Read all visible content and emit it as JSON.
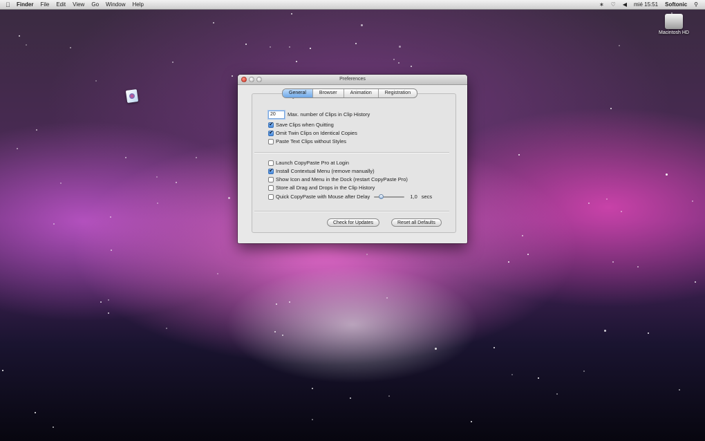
{
  "menubar": {
    "app_name": "Finder",
    "items": [
      "File",
      "Edit",
      "View",
      "Go",
      "Window",
      "Help"
    ],
    "clock": "mié 15:51",
    "user": "Softonic"
  },
  "desktop": {
    "hd_label": "Macintosh HD"
  },
  "window": {
    "title": "Preferences",
    "tabs": [
      {
        "label": "General",
        "active": true
      },
      {
        "label": "Browser",
        "active": false
      },
      {
        "label": "Animation",
        "active": false
      },
      {
        "label": "Registration",
        "active": false
      }
    ],
    "max_clips": {
      "value": "20",
      "label": "Max. number of Clips in Clip History"
    },
    "options_group1": [
      {
        "label": "Save Clips when Quitting",
        "checked": true
      },
      {
        "label": "Omit Twin Clips on Identical Copies",
        "checked": true
      },
      {
        "label": "Paste Text Clips without Styles",
        "checked": false
      }
    ],
    "options_group2": [
      {
        "label": "Launch CopyPaste Pro at Login",
        "checked": false
      },
      {
        "label": "Install Contextual Menu (remove manually)",
        "checked": true
      },
      {
        "label": "Show Icon and Menu in the Dock (restart CopyPaste Pro)",
        "checked": false
      },
      {
        "label": "Store all Drag and Drops in the Clip History",
        "checked": false
      }
    ],
    "quick_copypaste": {
      "label": "Quick CopyPaste with Mouse after Delay",
      "checked": false,
      "slider_fraction": 0.2,
      "value": "1,0",
      "unit": "secs"
    },
    "buttons": {
      "check_updates": "Check for Updates",
      "reset_defaults": "Reset all Defaults"
    }
  }
}
